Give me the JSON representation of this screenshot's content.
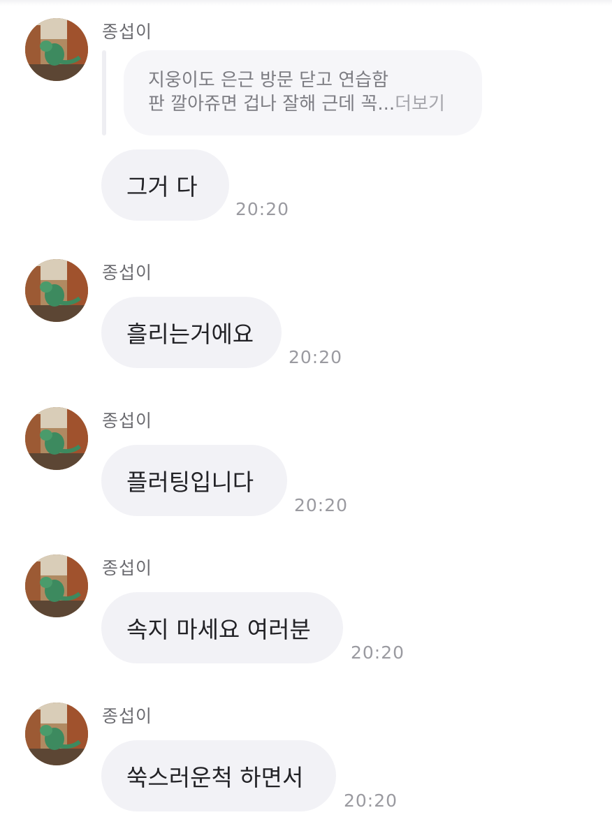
{
  "chat": {
    "messages": [
      {
        "sender": "종섭이",
        "reply_preview": {
          "line1": "지웅이도 은근 방문 닫고 연습함",
          "line2": "판 깔아쥬면 겁나 잘해 근데 꼭...",
          "more_label": "더보기"
        },
        "text": "그거 다",
        "time": "20:20"
      },
      {
        "sender": "종섭이",
        "text": "흘리는거에요",
        "time": "20:20"
      },
      {
        "sender": "종섭이",
        "text": "플러팅입니다",
        "time": "20:20"
      },
      {
        "sender": "종섭이",
        "text": "속지 마세요 여러분",
        "time": "20:20"
      },
      {
        "sender": "종섭이",
        "text": "쑥스러운척 하면서",
        "time": "20:20"
      }
    ]
  },
  "icons": {
    "avatar": "profile-photo-green-lizard-figure"
  },
  "colors": {
    "bubble_bg": "#f2f2f6",
    "reply_bg": "#f6f6f9",
    "timestamp": "#9a9aa0",
    "sender_name": "#6b6b70"
  }
}
